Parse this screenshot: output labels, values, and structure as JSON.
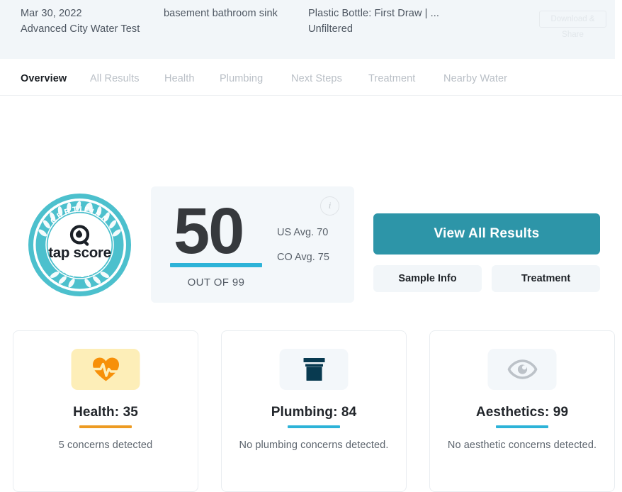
{
  "header": {
    "date": "Mar 30, 2022",
    "test_name": "Advanced City Water Test",
    "location": "basement bathroom sink",
    "location_line2": "",
    "sample_type": "Plastic Bottle: First Draw | ...",
    "filtration": "Unfiltered",
    "download_button": "Download & Share"
  },
  "tabs": [
    {
      "label": "Overview",
      "active": true,
      "name": "tab-overview"
    },
    {
      "label": "All Results",
      "active": false,
      "name": "tab-all-results"
    },
    {
      "label": "Health",
      "active": false,
      "name": "tab-health"
    },
    {
      "label": "Plumbing",
      "active": false,
      "name": "tab-plumbing"
    },
    {
      "label": "Next Steps",
      "active": false,
      "name": "tab-next-steps"
    },
    {
      "label": "Treatment",
      "active": false,
      "name": "tab-treatment"
    },
    {
      "label": "Nearby Water",
      "active": false,
      "name": "tab-nearby-water"
    }
  ],
  "badge": {
    "top_arc": "CERTIFIED",
    "bottom_arc": "REPORT",
    "brand": "tap score",
    "icon": "magnifier-droplet-icon"
  },
  "score": {
    "value": "50",
    "out_of_label": "OUT OF 99",
    "us_average": "US Avg. 70",
    "state_average": "CO Avg. 75",
    "info_icon_glyph": "i"
  },
  "actions": {
    "primary": "View All Results",
    "sample_info": "Sample Info",
    "treatment": "Treatment"
  },
  "cards": [
    {
      "name": "health",
      "icon": "heart-pulse-icon",
      "title": "Health: 35",
      "subtitle": "5 concerns detected",
      "bar_color": "#ed9b22",
      "tile_color": "#fdeeb8"
    },
    {
      "name": "plumbing",
      "icon": "pipe-icon",
      "title": "Plumbing: 84",
      "subtitle": "No plumbing concerns detected.",
      "bar_color": "#2db3d8",
      "tile_color": "#f3f7fa"
    },
    {
      "name": "aesthetics",
      "icon": "eye-icon",
      "title": "Aesthetics: 99",
      "subtitle": "No aesthetic concerns detected.",
      "bar_color": "#2db3d8",
      "tile_color": "#f3f7fa"
    }
  ],
  "colors": {
    "teal_primary": "#2d95a8",
    "teal_accent": "#2db3d8",
    "orange": "#ed9b22",
    "header_bg": "#f2f6f9",
    "navy": "#083a50"
  }
}
